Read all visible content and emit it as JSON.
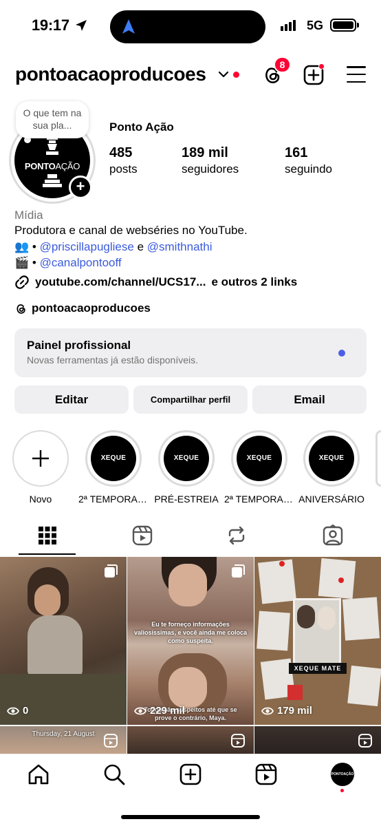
{
  "status_bar": {
    "time": "19:17",
    "network": "5G"
  },
  "header": {
    "username": "pontoacaoproducoes",
    "threads_badge": "8"
  },
  "profile": {
    "note": "O que tem na sua pla...",
    "avatar_logo_bold": "PONTO",
    "avatar_logo_thin": "AÇÃO",
    "display_name": "Ponto Ação",
    "stats": [
      {
        "value": "485",
        "label": "posts"
      },
      {
        "value": "189 mil",
        "label": "seguidores"
      },
      {
        "value": "161",
        "label": "seguindo"
      }
    ],
    "category": "Mídia",
    "bio_line1": "Produtora e canal de webséries no YouTube.",
    "bio_line2_emoji": "👥",
    "bio_line2_sep": " • ",
    "bio_line2_link1": "@priscillapugliese",
    "bio_line2_and": " e ",
    "bio_line2_link2": "@smithnathi",
    "bio_line3_emoji": "🎬",
    "bio_line3_sep": " • ",
    "bio_line3_link": "@canalpontooff",
    "link_text": "youtube.com/channel/UCS17...",
    "link_more": "e outros 2 links",
    "threads_handle": "pontoacaoproducoes"
  },
  "pro_panel": {
    "title": "Painel profissional",
    "subtitle": "Novas ferramentas já estão disponíveis.",
    "dot_color": "#4d5ee6"
  },
  "buttons": {
    "edit": "Editar",
    "share": "Compartilhar perfil",
    "email": "Email"
  },
  "highlights": [
    {
      "label": "Novo",
      "cover": ""
    },
    {
      "label": "2ª TEMPORADA",
      "cover": "XEQUE MATE"
    },
    {
      "label": "PRÉ-ESTREIA",
      "cover": "XEQUE MATE"
    },
    {
      "label": "2ª TEMPORADA",
      "cover": "XEQUE MATE"
    },
    {
      "label": "ANIVERSÁRIO",
      "cover": "XEQUE MATE"
    }
  ],
  "tabs": [
    "grid-icon",
    "reels-icon",
    "reposts-icon",
    "tagged-icon"
  ],
  "posts": [
    {
      "views": "0",
      "caption_top": "",
      "caption_bottom": ""
    },
    {
      "views": "229 mil",
      "caption_top": "Eu te forneço informações valiosíssimas, e você ainda me coloca como suspeita.",
      "caption_bottom": "Todos são suspeitos até que se prove o contrário, Maya."
    },
    {
      "views": "179 mil",
      "caption_top": "",
      "caption_bottom": "XEQUE MATE"
    }
  ],
  "posts_row2": [
    {
      "caption": "Thursday, 21 August"
    },
    {
      "caption": ""
    },
    {
      "caption": ""
    }
  ],
  "nav": [
    "home-icon",
    "search-icon",
    "create-icon",
    "reels-icon",
    "profile-avatar"
  ],
  "colors": {
    "accent_red": "#ff0033",
    "link_blue": "#3b5bdb",
    "panel_gray": "#efeff1"
  }
}
